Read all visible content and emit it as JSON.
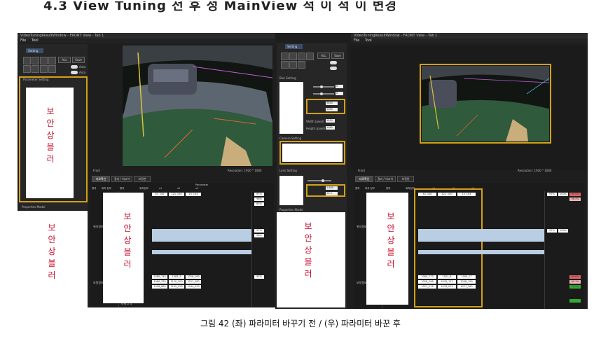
{
  "heading": "4.3 View Tuning 전 후 성 MainView 적 이 적 이 변경",
  "left_window": {
    "title": "VideoTuningResultWindow - FRONT View - Tab 1",
    "menu": [
      "File",
      "Tool"
    ],
    "sidebar_tab": "Setting",
    "buttons": [
      "ALL",
      "Save"
    ],
    "toggle_labels": [
      "Auto",
      "Auto"
    ],
    "panel_header": "Parameter Setting",
    "properties_header": "Properties Model",
    "camera_label": "Front",
    "resolution": "Resolution: 1920 * 1080",
    "tabs": [
      "자료확인",
      "결과 / 비교이",
      "보정변"
    ],
    "masked_label_top": "보안상블러",
    "masked_label_bottom": "보안상블러",
    "masked_label_table": "보안상블러",
    "table_header_group": "Parameter",
    "table_cols": [
      "항목",
      "위치 정보",
      "항목",
      "위치정보",
      "x1",
      "x2",
      "x3"
    ],
    "section_labels": [
      "위치정보",
      "보정정보"
    ],
    "row_values": [
      [
        "-",
        "X1_100",
        "121_100",
        "15_104"
      ],
      [
        "-",
        "1080_740",
        "1083_3",
        "1026_160"
      ],
      [
        "-",
        "1060_370",
        "1120_500",
        "1021_280"
      ],
      [
        "-",
        "1028_880",
        "1195_026",
        "1044_520"
      ]
    ],
    "right_col_values": [
      "97%",
      "98%",
      "85%",
      "97%",
      "98%",
      "97%"
    ],
    "bottom_row_label": "라벨 2 3"
  },
  "right_window": {
    "title": "VideoTuningResultWindow - FRONT View - Tab 1",
    "menu": [
      "File",
      "Tool"
    ],
    "sidebar_tab": "Setting",
    "buttons": [
      "ALL",
      "Save"
    ],
    "panel_header": "Blur Setting",
    "section_headers": [
      "Camera Setting",
      "Lens Setting",
      "Properties Model"
    ],
    "field_labels": [
      "Width (pixel)",
      "Height (pixel)"
    ],
    "field_values": [
      "1920",
      "1080"
    ],
    "slider_values": [
      "0",
      "0",
      "3840",
      "1080",
      "1.800",
      "10.0"
    ],
    "camera_label": "Front",
    "resolution": "Resolution: 1920 * 1080",
    "tabs": [
      "자료확인",
      "결과 / 비교이",
      "보정변"
    ],
    "masked_label_top": "보안상블러",
    "masked_label_table": "보안상블러",
    "masked_label_bottom": "보안상블러",
    "table_cols": [
      "항목",
      "위치 정보",
      "항목",
      "위치정보",
      "x1",
      "x2",
      "x3"
    ],
    "section_labels": [
      "위치정보",
      "보정정보"
    ],
    "row_values": [
      [
        "-",
        "X1_100",
        "121_100",
        "15_104"
      ],
      [
        "-",
        "1080_173",
        "1021_8",
        "1005_17"
      ],
      [
        "-",
        "1026_198",
        "1043_112",
        "1048_190"
      ],
      [
        "-",
        "1021_278",
        "1076_070",
        "1027_280"
      ]
    ],
    "pct_values": [
      "97%",
      "100%",
      "99.5%",
      "98.4%",
      "97%",
      "100%",
      "99.6%",
      "99.1%",
      "79.3%"
    ],
    "colors": {
      "red": "#e06666",
      "green": "#33aa33"
    }
  },
  "caption": "그림 42 (좌) 파라미터 바꾸기 전 / (우) 파라미터 바꾼 후"
}
